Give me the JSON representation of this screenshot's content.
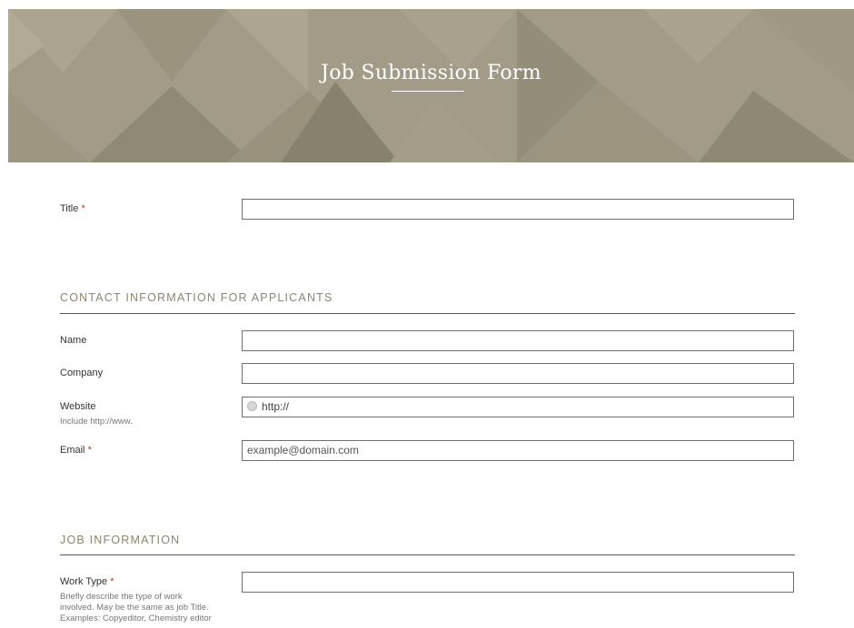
{
  "header": {
    "title": "Job Submission Form",
    "background_color": "#a09a86",
    "title_color": "#ffffff"
  },
  "required_marker": "*",
  "fields": {
    "title": {
      "label": "Title",
      "required": true,
      "value": ""
    },
    "name": {
      "label": "Name",
      "required": false,
      "value": ""
    },
    "company": {
      "label": "Company",
      "required": false,
      "value": ""
    },
    "website": {
      "label": "Website",
      "help": "Include http://www.",
      "value": "http://",
      "icon": "globe-icon"
    },
    "email": {
      "label": "Email",
      "required": true,
      "placeholder": "example@domain.com"
    },
    "work_type": {
      "label": "Work Type",
      "required": true,
      "help_lines": [
        "Briefly describe the type of work",
        "involved. May be the same as job Title.",
        "Examples: Copyeditor, Chemistry editor"
      ],
      "value": ""
    }
  },
  "sections": {
    "contact": "CONTACT INFORMATION FOR APPLICANTS",
    "job": "JOB INFORMATION"
  },
  "colors": {
    "accent": "#8b8670",
    "required": "#c0392b"
  }
}
